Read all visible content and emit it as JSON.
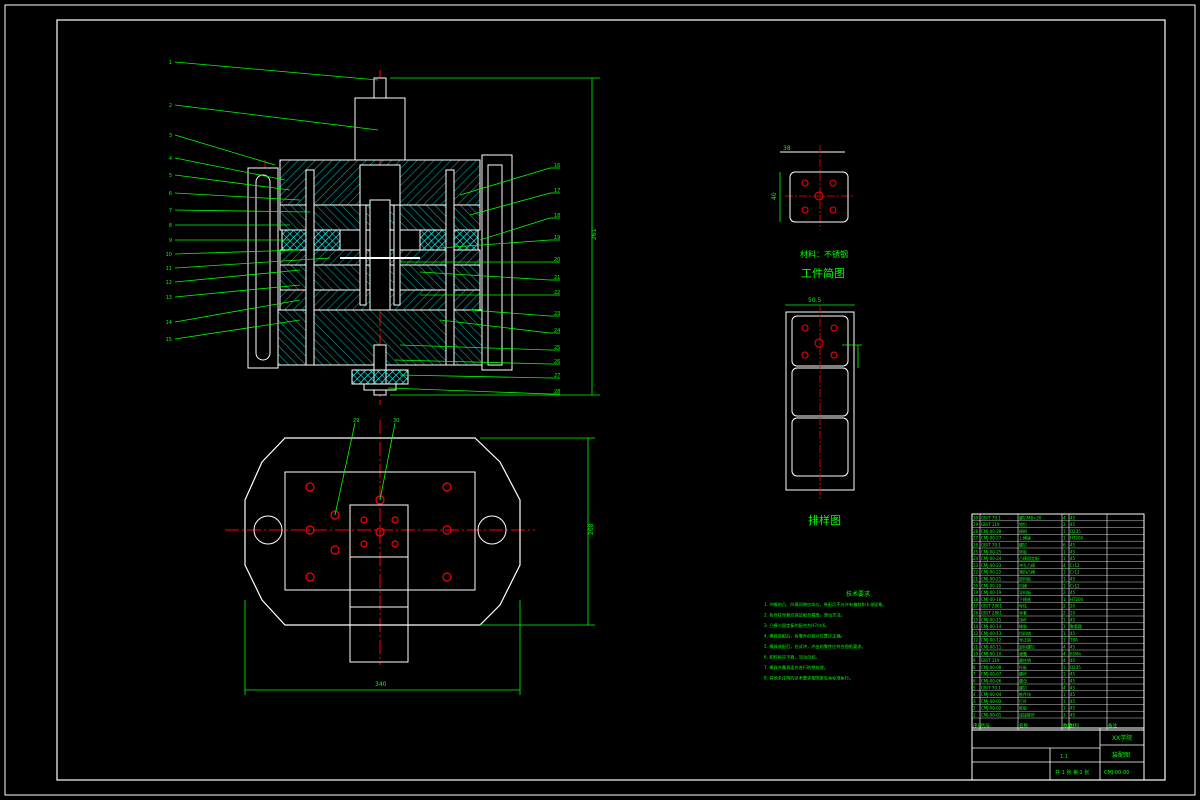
{
  "drawing": {
    "workpiece_material_label": "材料：不锈钢",
    "workpiece_title": "工件简图",
    "strip_title": "排样图",
    "tech_req_title": "技术要求",
    "tech_req_lines": [
      "1. 冲模的凸、凹模间隙应均匀，装配后不允许有偏斜和卡滞现象。",
      "2. 各导柱导套应保证配合精度，滑动灵活。",
      "3. 凸模与固定板的配合为H7/m6。",
      "4. 模具装配后，各零件的相对位置应正确。",
      "5. 模具装配后，应试冲，冲出的零件应符合图纸要求。",
      "6. 卸料板应平稳，活动自如。",
      "7. 模具外露表面应进行防锈处理。",
      "8. 其他未注明的技术要求按国家有关标准执行。"
    ],
    "callouts_left": [
      "1",
      "2",
      "3",
      "4",
      "5",
      "6",
      "7",
      "8",
      "9",
      "10",
      "11",
      "12",
      "13",
      "14",
      "15"
    ],
    "callouts_right": [
      "16",
      "17",
      "18",
      "19",
      "20",
      "21",
      "22",
      "23",
      "24",
      "25",
      "26",
      "27",
      "28"
    ],
    "callouts_plan": [
      "29",
      "30"
    ],
    "dim_labels": {
      "overall_height": "261",
      "plan_width": "340",
      "plan_depth": "208",
      "strip_width": "50.5",
      "part_width": "38",
      "part_height": "40"
    },
    "title_block": {
      "school": "XX学院",
      "drawing_name": "装配图",
      "drawing_no": "CMJ-00-00",
      "sheet": "共 1 张  第 1 张",
      "scale": "1:1"
    },
    "bom_header": [
      "序号",
      "代号",
      "名称",
      "数量",
      "材料",
      "备注"
    ],
    "bom_rows": [
      [
        "30",
        "GB/T 70.1",
        "螺钉M8×20",
        "4",
        "45",
        ""
      ],
      [
        "29",
        "GB/T 119",
        "销钉",
        "2",
        "45",
        ""
      ],
      [
        "28",
        "CMJ-00-28",
        "模柄",
        "1",
        "Q235",
        ""
      ],
      [
        "27",
        "CMJ-00-27",
        "上模座",
        "1",
        "HT200",
        ""
      ],
      [
        "26",
        "GB/T 70.1",
        "螺钉",
        "6",
        "45",
        ""
      ],
      [
        "25",
        "CMJ-00-25",
        "垫板",
        "1",
        "45",
        ""
      ],
      [
        "24",
        "CMJ-00-24",
        "凸模固定板",
        "1",
        "45",
        ""
      ],
      [
        "23",
        "CMJ-00-23",
        "冲孔凸模",
        "4",
        "Cr12",
        ""
      ],
      [
        "22",
        "CMJ-00-22",
        "落料凸模",
        "1",
        "Cr12",
        ""
      ],
      [
        "21",
        "CMJ-00-21",
        "卸料板",
        "1",
        "45",
        ""
      ],
      [
        "20",
        "CMJ-00-20",
        "凹模",
        "1",
        "Cr12",
        ""
      ],
      [
        "19",
        "CMJ-00-19",
        "导料板",
        "2",
        "45",
        ""
      ],
      [
        "18",
        "CMJ-00-18",
        "下模座",
        "1",
        "HT200",
        ""
      ],
      [
        "17",
        "GB/T 2861",
        "导柱",
        "2",
        "20",
        ""
      ],
      [
        "16",
        "GB/T 2861",
        "导套",
        "2",
        "20",
        ""
      ],
      [
        "15",
        "CMJ-00-15",
        "顶杆",
        "1",
        "45",
        ""
      ],
      [
        "14",
        "CMJ-00-14",
        "橡胶",
        "1",
        "聚氨酯",
        ""
      ],
      [
        "13",
        "CMJ-00-13",
        "挡料销",
        "1",
        "45",
        ""
      ],
      [
        "12",
        "CMJ-00-12",
        "导正销",
        "1",
        "T8A",
        ""
      ],
      [
        "11",
        "CMJ-00-11",
        "卸料螺钉",
        "4",
        "45",
        ""
      ],
      [
        "10",
        "CMJ-00-10",
        "弹簧",
        "4",
        "65Mn",
        ""
      ],
      [
        "9",
        "GB/T 119",
        "圆柱销",
        "4",
        "45",
        ""
      ],
      [
        "8",
        "CMJ-00-08",
        "托板",
        "1",
        "Q235",
        ""
      ],
      [
        "7",
        "CMJ-00-07",
        "螺杆",
        "1",
        "45",
        ""
      ],
      [
        "6",
        "CMJ-00-06",
        "螺母",
        "1",
        "45",
        ""
      ],
      [
        "5",
        "GB/T 70.1",
        "螺钉",
        "4",
        "45",
        ""
      ],
      [
        "4",
        "CMJ-00-04",
        "推件块",
        "1",
        "45",
        ""
      ],
      [
        "3",
        "CMJ-00-03",
        "打杆",
        "1",
        "45",
        ""
      ],
      [
        "2",
        "CMJ-00-02",
        "推板",
        "1",
        "45",
        ""
      ],
      [
        "1",
        "CMJ-00-01",
        "连接推杆",
        "3",
        "45",
        ""
      ]
    ],
    "colors": {
      "background": "#000000",
      "frame": "#ffffff",
      "outline": "#ffffff",
      "dimension": "#00ff00",
      "centerline": "#ff0000",
      "hatch": "#00a3a3",
      "rubber": "#00ffff"
    }
  }
}
